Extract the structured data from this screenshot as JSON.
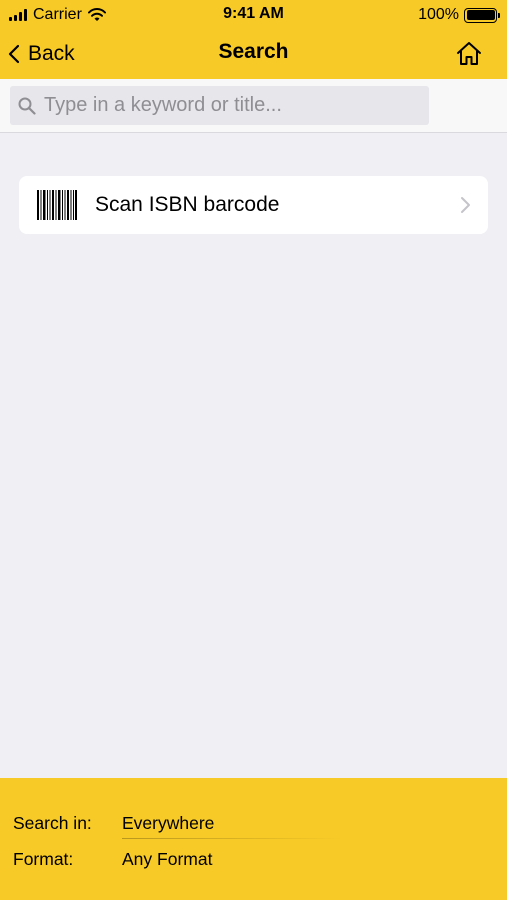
{
  "status_bar": {
    "carrier": "Carrier",
    "time": "9:41 AM",
    "battery": "100%",
    "battery_level": 1.0,
    "signal_bars": 4
  },
  "nav": {
    "back_label": "Back",
    "title": "Search",
    "home_icon": "home-icon"
  },
  "search": {
    "placeholder": "Type in a keyword or title...",
    "value": ""
  },
  "scan": {
    "label": "Scan ISBN barcode",
    "icon": "barcode-icon"
  },
  "filters": {
    "search_in_label": "Search in:",
    "search_in_value": "Everywhere",
    "format_label": "Format:",
    "format_value": "Any Format"
  },
  "colors": {
    "accent": "#f7ca27",
    "background": "#efeff4",
    "placeholder": "#8e8e93"
  }
}
